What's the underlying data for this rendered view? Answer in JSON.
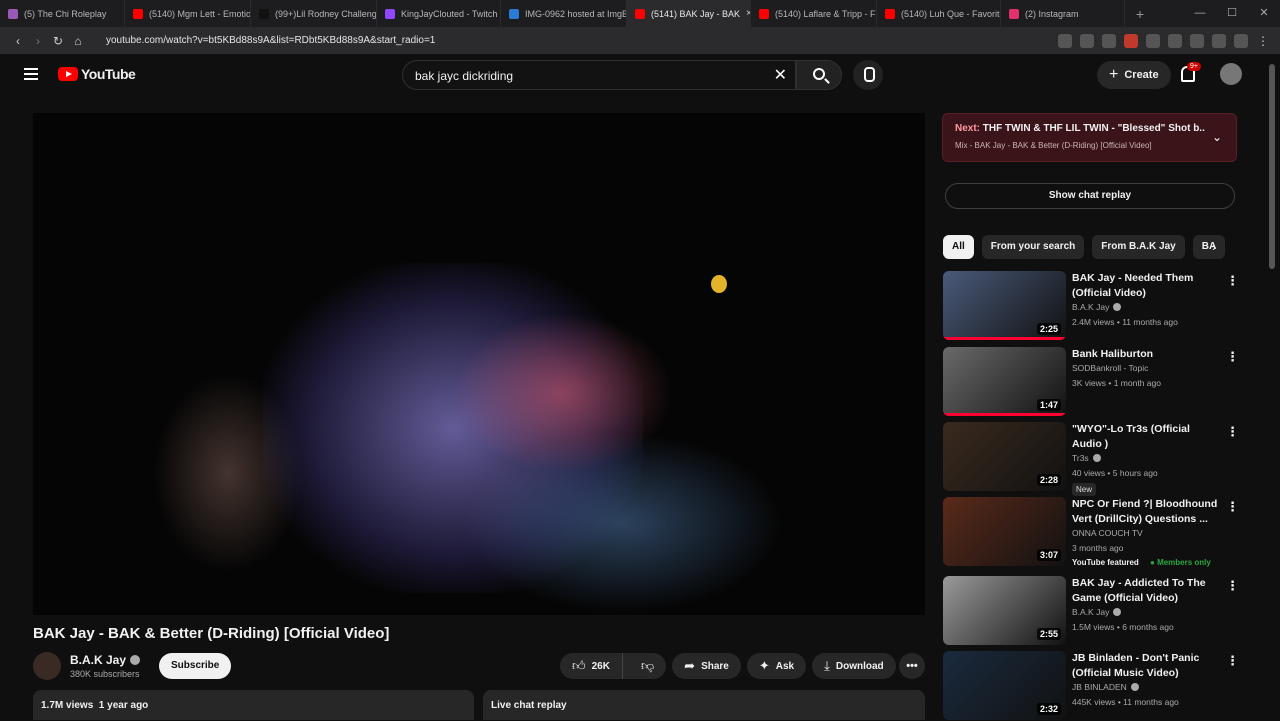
{
  "tabs": [
    {
      "label": "(5) The Chi Roleplay",
      "color": "#9b59b6"
    },
    {
      "label": "(5140) Mgm Lett - Emotio",
      "color": "#ff0000"
    },
    {
      "label": "(99+)Lil Rodney Challeng",
      "color": "#111111"
    },
    {
      "label": "KingJayClouted - Twitch",
      "color": "#9146ff"
    },
    {
      "label": "IMG-0962 hosted at ImgB",
      "color": "#2a7bd5"
    },
    {
      "label": "(5141) BAK Jay - BAK",
      "color": "#ff0000",
      "close": "×"
    },
    {
      "label": "(5140) Laflare & Tripp - F",
      "color": "#ff0000"
    },
    {
      "label": "(5140) Luh Que - Favorite",
      "color": "#ff0000"
    },
    {
      "label": "(2) Instagram",
      "color": "#e1306c"
    }
  ],
  "new_tab_glyph": "+",
  "url": "youtube.com/watch?v=bt5KBd88s9A&list=RDbt5KBd88s9A&start_radio=1",
  "header": {
    "logo_text": "YouTube",
    "search_value": "bak jayc dickriding",
    "create_label": "Create",
    "notification_count": "9+"
  },
  "video": {
    "title": "BAK Jay - BAK & Better (D-Riding) [Official Video]",
    "channel": "B.A.K Jay",
    "subscribers": "380K subscribers",
    "subscribe_label": "Subscribe",
    "likes": "26K",
    "share_label": "Share",
    "ask_label": "Ask",
    "download_label": "Download",
    "more_label": "•••",
    "views_line": "1.7M views  1 year ago",
    "live_chat_label": "Live chat replay"
  },
  "sidebar": {
    "next_label": "Next:",
    "next_title": "THF TWIN & THF LIL TWIN - \"Blessed\" Shot b...",
    "next_sub": "Mix - BAK Jay - BAK & Better (D-Riding) [Official Video]",
    "show_chat_label": "Show chat replay",
    "chips": [
      {
        "label": "All",
        "active": true
      },
      {
        "label": "From your search"
      },
      {
        "label": "From B.A.K Jay"
      },
      {
        "label": "BA"
      }
    ],
    "recommendations": [
      {
        "title": "BAK Jay - Needed Them (Official Video)",
        "channel": "B.A.K Jay",
        "verified": true,
        "meta": "2.4M views • 11 months ago",
        "duration": "2:25",
        "thumb": "#4a5a7a"
      },
      {
        "title": "Bank Haliburton",
        "channel": "SODBankroll - Topic",
        "meta": "3K views • 1 month ago",
        "duration": "1:47",
        "thumb": "#6a6a6a"
      },
      {
        "title": "\"WYO\"-Lo Tr3s (Official Audio )",
        "channel": "Tr3s",
        "verified": true,
        "meta": "40 views • 5 hours ago",
        "duration": "2:28",
        "tag": "New",
        "thumb": "#3a2a1e"
      },
      {
        "title": "NPC Or Fiend ?| Bloodhound Vert (DrillCity) Questions ...",
        "channel": "ONNA COUCH TV",
        "meta": "3 months ago",
        "duration": "3:07",
        "featured": "YouTube featured",
        "members": "Members only",
        "thumb": "#5a2a1a"
      },
      {
        "title": "BAK Jay - Addicted To The Game (Official Video)",
        "channel": "B.A.K Jay",
        "verified": true,
        "meta": "1.5M views • 6 months ago",
        "duration": "2:55",
        "thumb": "#9a9a9a"
      },
      {
        "title": "JB Binladen - Don't Panic (Official Music Video)",
        "channel": "JB BINLADEN",
        "verified": true,
        "meta": "445K views • 11 months ago",
        "duration": "2:32",
        "thumb": "#1a2a3e"
      }
    ]
  }
}
